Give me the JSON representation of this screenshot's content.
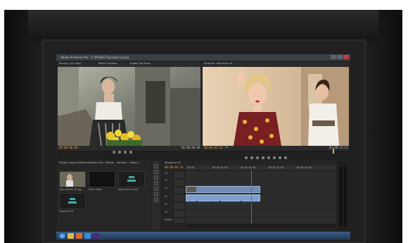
{
  "app": {
    "title": "Adobe Premiere Pro - C:\\PROJECTS\\project.prproj"
  },
  "source_monitor": {
    "tabs": [
      "Source: (no clips)",
      "Effect Controls",
      "Audio Clip Mixer"
    ],
    "timecode_left": "00:00:00:00",
    "timecode_right": "00:00:04:08"
  },
  "program_monitor": {
    "tabs": [
      "Program: Sequence 01"
    ],
    "timecode_left": "00:00:03:16",
    "fit": "Fit",
    "timecode_right": "00:00:15:21"
  },
  "project_panel": {
    "tabs": [
      "Project: project",
      "Media Browser",
      "Info",
      "Effects",
      "Markers",
      "History"
    ],
    "clips": [
      {
        "name": "shot_woman_01.jpg"
      },
      {
        "name": "Black Video"
      },
      {
        "name": "Adjustment Layer"
      },
      {
        "name": "Sequence 01"
      }
    ]
  },
  "timeline": {
    "tabs": [
      "Sequence 01"
    ],
    "timecode": "00:00:03:16",
    "ruler": [
      "00:00",
      "00:00:05:00",
      "00:00:10:00",
      "00:00:15:00",
      "00:00:20:00"
    ],
    "tracks": [
      "V3",
      "V2",
      "V1",
      "A1",
      "A2",
      "A3",
      "Master"
    ]
  },
  "taskbar": {
    "icons": [
      "start-icon",
      "explorer-icon",
      "media-icon",
      "browser-icon",
      "premiere-icon"
    ]
  },
  "colors": {
    "accent_timecode": "#e8a040",
    "video_clip": "#6f8bb4",
    "audio_clip": "#7f9fcf",
    "playhead": "#d04040"
  }
}
